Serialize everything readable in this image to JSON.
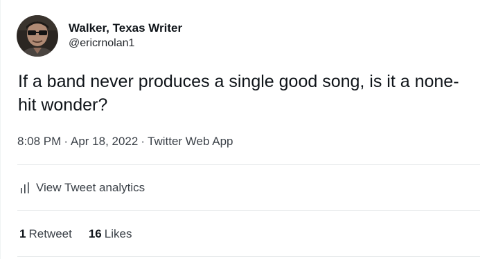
{
  "author": {
    "display_name": "Walker, Texas Writer",
    "handle": "@ericrnolan1"
  },
  "tweet": {
    "text": "If a band never produces a single good song, is it a none-hit wonder?",
    "time": "8:08 PM",
    "date": "Apr 18, 2022",
    "separator": "·",
    "source": "Twitter Web App"
  },
  "analytics": {
    "label": "View Tweet analytics",
    "icon": "bar-chart-icon"
  },
  "stats": {
    "retweets_count": "1",
    "retweets_label": "Retweet",
    "likes_count": "16",
    "likes_label": "Likes"
  },
  "colors": {
    "text_primary": "#0f1419",
    "text_secondary": "#3b4148",
    "divider": "#e6e9ea",
    "background": "#ffffff"
  }
}
